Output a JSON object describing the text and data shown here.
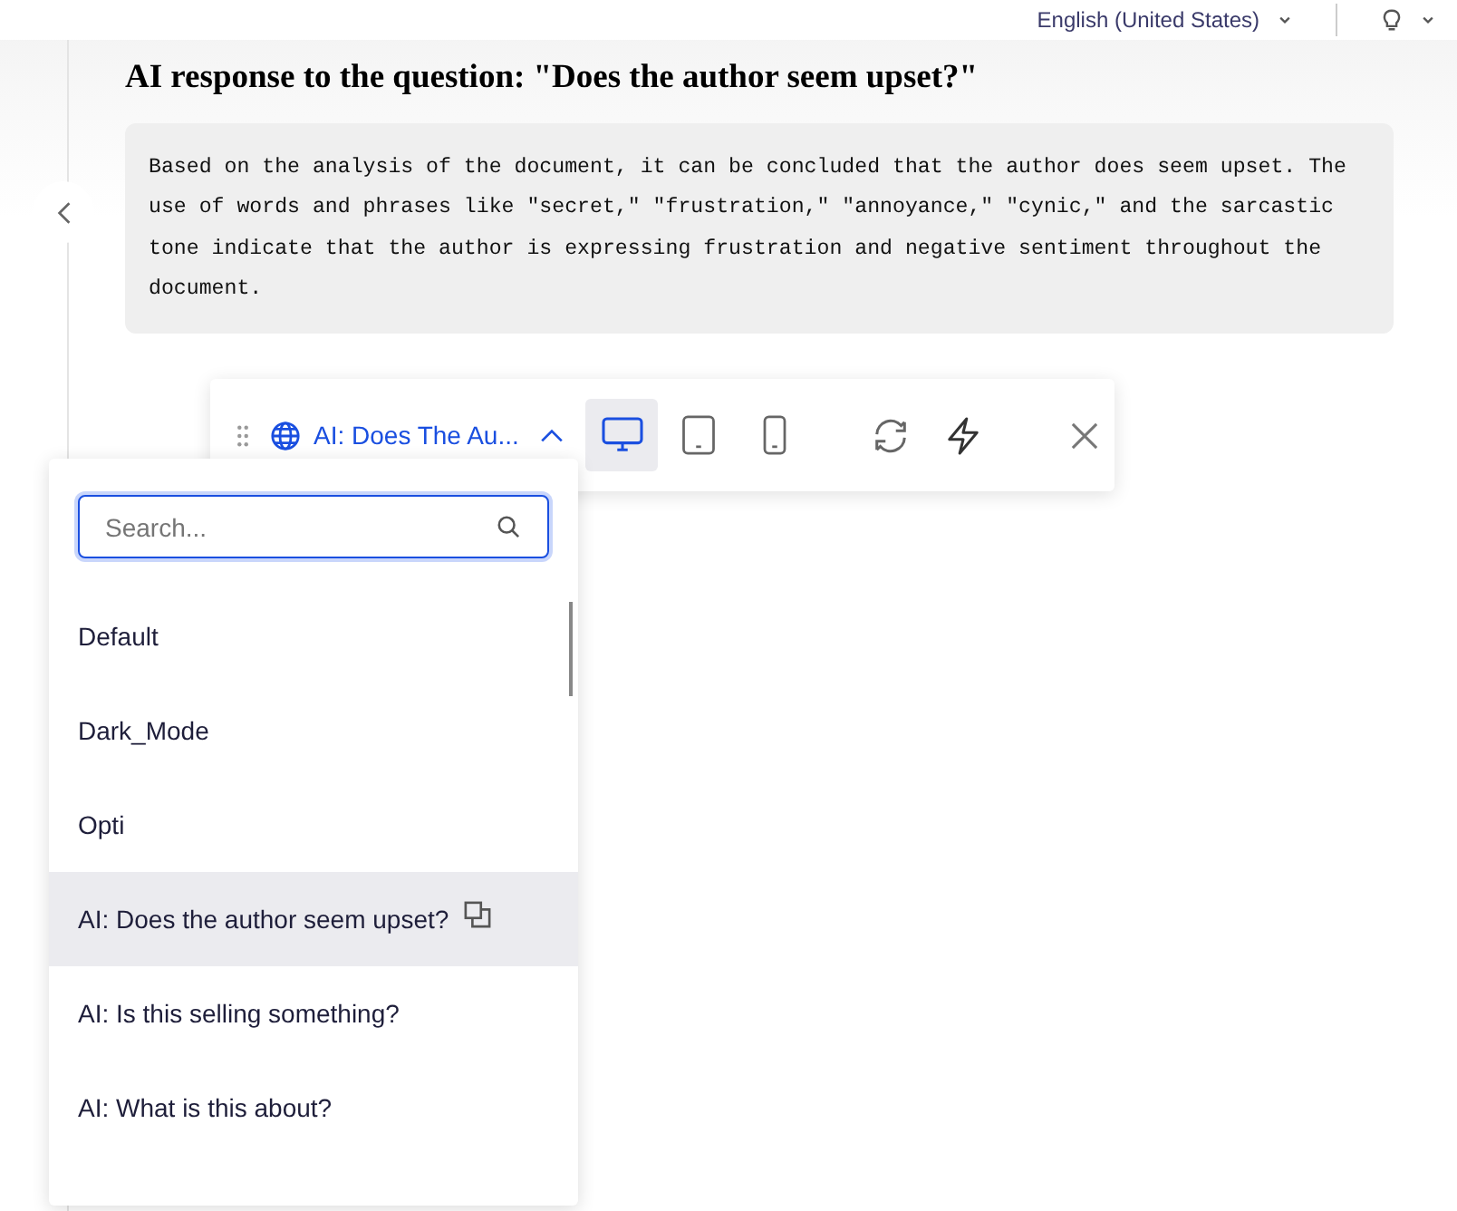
{
  "top_bar": {
    "language": "English (United States)"
  },
  "response": {
    "title": "AI response to the question: \"Does the author seem upset?\"",
    "text": "Based on the analysis of the document, it can be concluded that the author does seem upset. The use of words and phrases like \"secret,\" \"frustration,\" \"annoyance,\" \"cynic,\" and the sarcastic tone indicate that the author is expressing frustration and negative sentiment throughout the document."
  },
  "toolbar": {
    "variant": "AI: Does The Au...",
    "expanded": true,
    "devices": [
      {
        "kind": "desktop",
        "selected": true
      },
      {
        "kind": "tablet",
        "selected": false
      },
      {
        "kind": "phone",
        "selected": false
      }
    ]
  },
  "dropdown": {
    "search": {
      "placeholder": "Search..."
    },
    "items": [
      {
        "label": "Default",
        "selected": false
      },
      {
        "label": "Dark_Mode",
        "selected": false
      },
      {
        "label": "Opti",
        "selected": false
      },
      {
        "label": "AI: Does the author seem upset?",
        "selected": true
      },
      {
        "label": "AI: Is this selling something?",
        "selected": false
      },
      {
        "label": "AI: What is this about?",
        "selected": false
      }
    ]
  }
}
